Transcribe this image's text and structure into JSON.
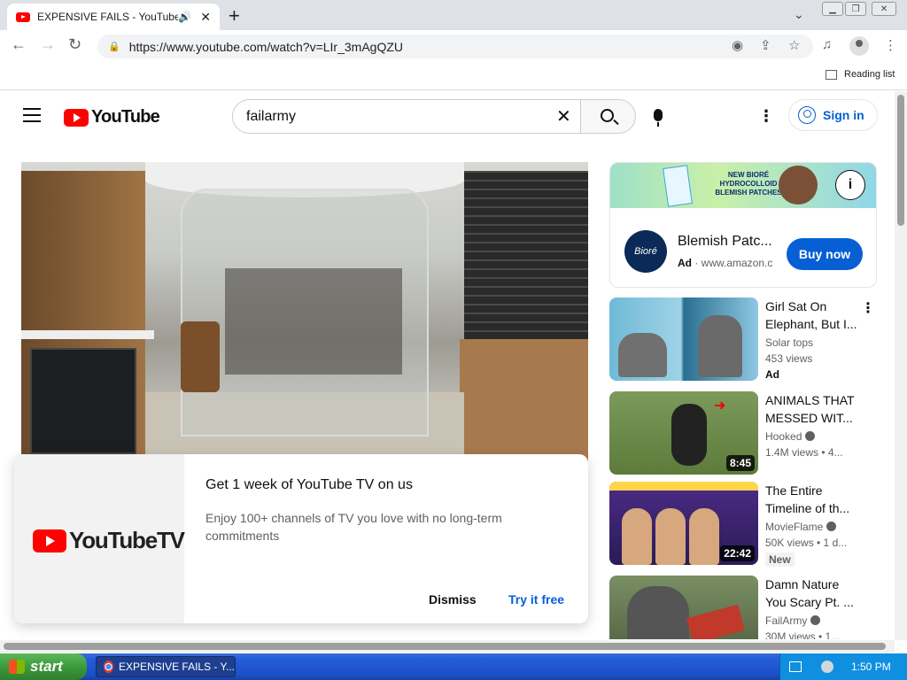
{
  "browser": {
    "tab_title": "EXPENSIVE FAILS - YouTube",
    "url": "https://www.youtube.com/watch?v=LIr_3mAgQZU",
    "reading_list": "Reading list"
  },
  "youtube": {
    "logo_text": "YouTube",
    "search_value": "failarmy",
    "signin_label": "Sign in"
  },
  "promo": {
    "logo_text": "YouTubeTV",
    "title": "Get 1 week of YouTube TV on us",
    "description": "Enjoy 100+ channels of TV you love with no long-term commitments",
    "dismiss_label": "Dismiss",
    "try_label": "Try it free"
  },
  "ad": {
    "banner_text": "NEW BIORÉ HYDROCOLLOID BLEMISH PATCHES",
    "brand_logo": "Bioré",
    "title": "Blemish Patc...",
    "ad_label": "Ad",
    "domain": "www.amazon.c",
    "buy_label": "Buy now"
  },
  "recommendations": [
    {
      "title": "Girl Sat On Elephant, But I...",
      "channel": "Solar tops",
      "meta": "453 views",
      "badge": "Ad",
      "duration": ""
    },
    {
      "title": "ANIMALS THAT MESSED WIT...",
      "channel": "Hooked",
      "meta": "1.4M views  • 4...",
      "badge": "",
      "duration": "8:45"
    },
    {
      "title": "The Entire Timeline of th...",
      "channel": "MovieFlame",
      "meta": "50K views  • 1 d...",
      "badge": "New",
      "duration": "22:42"
    },
    {
      "title": "Damn Nature You Scary Pt. ...",
      "channel": "FailArmy",
      "meta": "30M views  • 1...",
      "badge": "",
      "duration": ""
    }
  ],
  "taskbar": {
    "start_label": "start",
    "task_item": "EXPENSIVE FAILS - Y...",
    "clock": "1:50 PM"
  }
}
